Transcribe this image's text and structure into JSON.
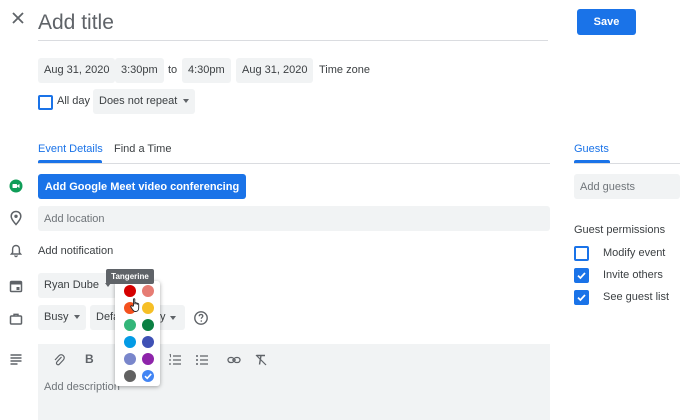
{
  "header": {
    "title_placeholder": "Add title",
    "save_label": "Save"
  },
  "datetime": {
    "start_date": "Aug 31, 2020",
    "start_time": "3:30pm",
    "to_label": "to",
    "end_time": "4:30pm",
    "end_date": "Aug 31, 2020",
    "timezone_label": "Time zone",
    "all_day_label": "All day",
    "all_day_checked": false,
    "repeat_label": "Does not repeat"
  },
  "tabs": [
    {
      "label": "Event Details",
      "active": true
    },
    {
      "label": "Find a Time",
      "active": false
    }
  ],
  "details": {
    "meet_label": "Add Google Meet video conferencing",
    "location_placeholder": "Add location",
    "notification_label": "Add notification",
    "calendar_owner": "Ryan Dube",
    "availability": "Busy",
    "visibility_visible": "Defa",
    "visibility_tail": "y",
    "description_placeholder": "Add description"
  },
  "color_picker": {
    "tooltip": "Tangerine",
    "hovered": "Tangerine",
    "selected_index": 11,
    "colors": [
      "#d50000",
      "#e67c73",
      "#f4511e",
      "#f6bf26",
      "#33b679",
      "#0b8043",
      "#039be5",
      "#3f51b5",
      "#7986cb",
      "#8e24aa",
      "#616161",
      "#4285f4"
    ]
  },
  "guests": {
    "tab_label": "Guests",
    "input_placeholder": "Add guests",
    "permissions_title": "Guest permissions",
    "permissions": [
      {
        "label": "Modify event",
        "checked": false
      },
      {
        "label": "Invite others",
        "checked": true
      },
      {
        "label": "See guest list",
        "checked": true
      }
    ]
  },
  "colors": {
    "accent": "#1a73e8",
    "field_bg": "#f1f3f4",
    "meet_icon": "#0f9d58",
    "text": "#3c4043"
  },
  "icons": {
    "close": "close-icon",
    "meet": "video-camera-icon",
    "location": "location-pin-icon",
    "notification": "bell-icon",
    "calendar": "calendar-icon",
    "availability": "briefcase-icon",
    "help": "help-icon",
    "description": "notes-icon"
  }
}
